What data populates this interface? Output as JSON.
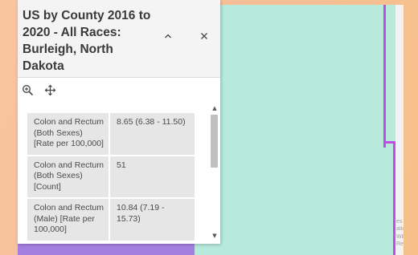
{
  "popup": {
    "title": "US by County 2016 to 2020 - All Races: Burleigh, North Dakota",
    "collapse_icon": "chevron-up-icon",
    "close_icon": "close-icon",
    "toolbar": {
      "zoom_icon": "zoom-to-icon",
      "pan_icon": "pan-move-icon"
    },
    "rows": [
      {
        "field": "Colon and Rectum (Both Sexes) [Rate per 100,000]",
        "value": "8.65 (6.38 - 11.50)"
      },
      {
        "field": "Colon and Rectum (Both Sexes) [Count]",
        "value": "51"
      },
      {
        "field": "Colon and Rectum (Male) [Rate per 100,000]",
        "value": "10.84 (7.19 - 15.73)"
      }
    ]
  },
  "map": {
    "labels": [
      "es",
      "atio",
      "Wild",
      "Refu"
    ],
    "colors": {
      "county_fill": "#b8eadc",
      "county_border": "#c24ce6",
      "neighbor_fill": "#a57fe0"
    }
  }
}
